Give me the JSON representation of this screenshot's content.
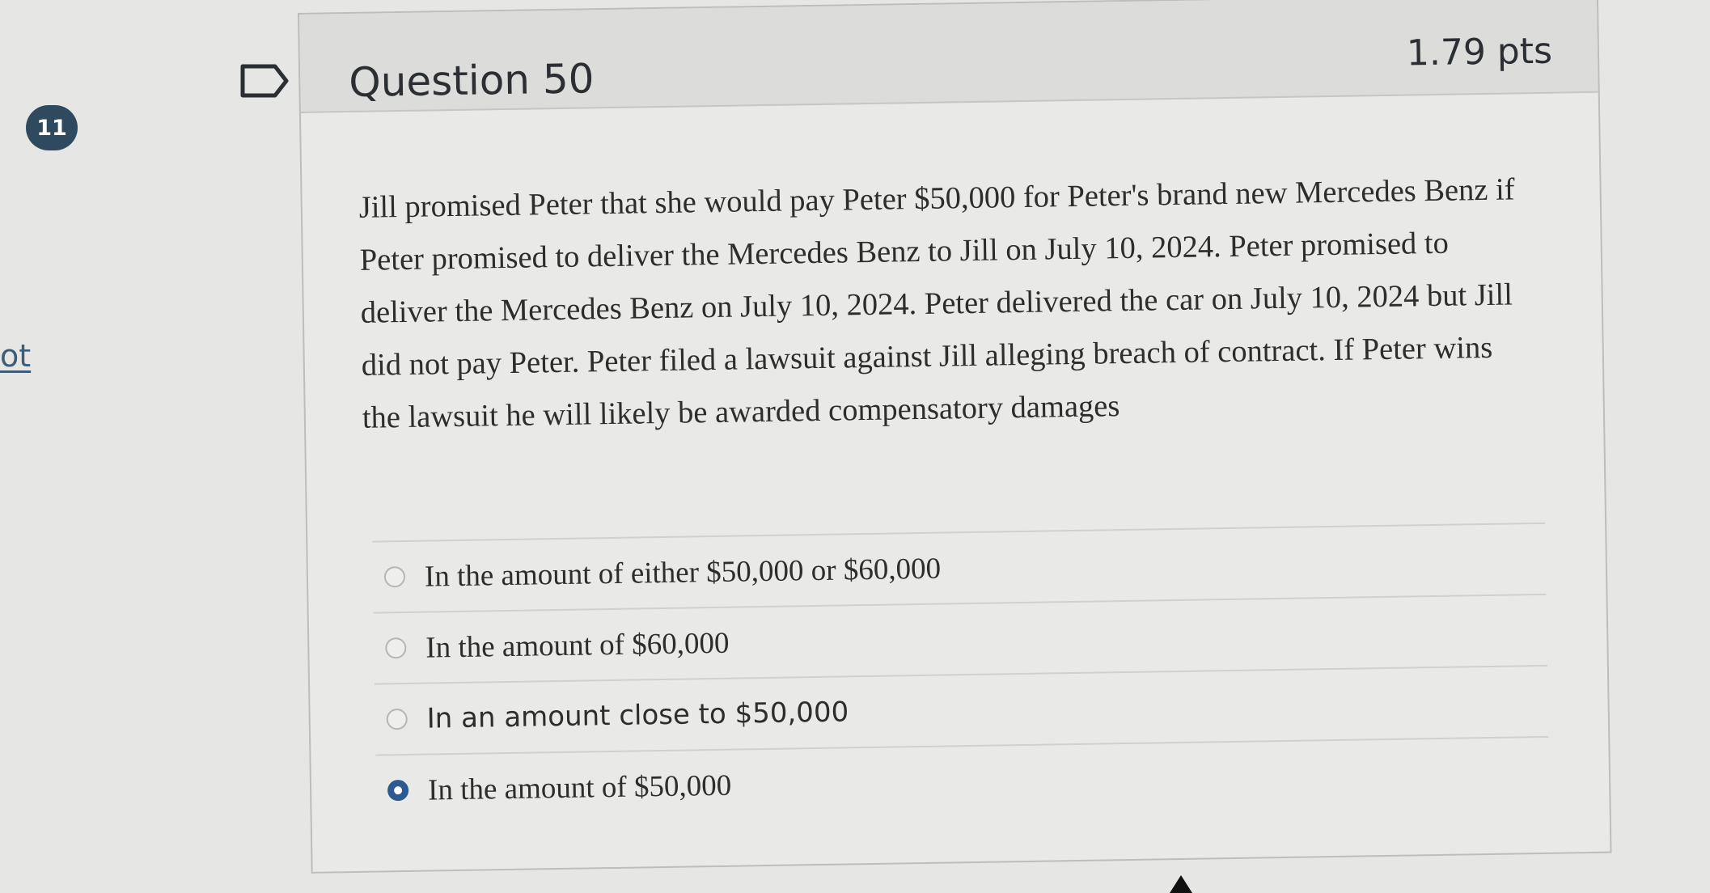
{
  "sidebar": {
    "badge_count": "11",
    "link_text": "ot"
  },
  "question": {
    "title": "Question 50",
    "points": "1.79 pts",
    "text": "Jill promised Peter that she would pay Peter $50,000 for Peter's brand new Mercedes Benz if Peter promised to deliver the Mercedes Benz to Jill on July 10, 2024.  Peter promised to deliver the Mercedes Benz on July 10, 2024.  Peter delivered the car on July 10, 2024 but Jill did not pay Peter.  Peter filed a lawsuit against Jill alleging breach of contract.  If Peter wins the lawsuit he will likely be awarded compensatory damages"
  },
  "answers": [
    {
      "label": "In the amount of either $50,000 or $60,000",
      "selected": false
    },
    {
      "label": "In the amount of $60,000",
      "selected": false
    },
    {
      "label": "In an amount close to $50,000",
      "selected": false
    },
    {
      "label": "In the amount of $50,000",
      "selected": true
    }
  ],
  "colors": {
    "badge": "#2f4a5e",
    "selected_radio": "#2d5b91",
    "link": "#3f5d78"
  },
  "icons": [
    "flag-question-icon",
    "radio-unchecked-icon",
    "radio-checked-icon",
    "mouse-cursor-icon"
  ]
}
